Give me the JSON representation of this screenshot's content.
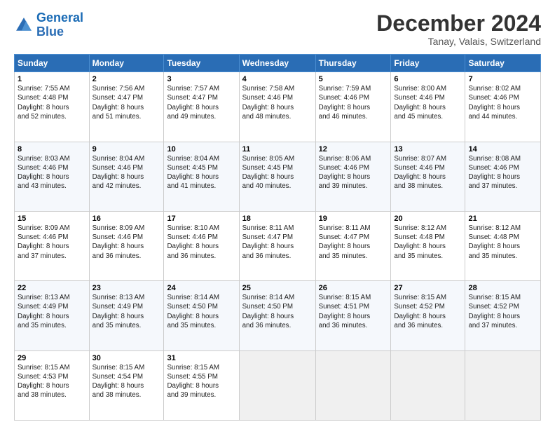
{
  "logo": {
    "line1": "General",
    "line2": "Blue"
  },
  "title": "December 2024",
  "subtitle": "Tanay, Valais, Switzerland",
  "days_header": [
    "Sunday",
    "Monday",
    "Tuesday",
    "Wednesday",
    "Thursday",
    "Friday",
    "Saturday"
  ],
  "weeks": [
    [
      {
        "day": "1",
        "info": "Sunrise: 7:55 AM\nSunset: 4:48 PM\nDaylight: 8 hours\nand 52 minutes."
      },
      {
        "day": "2",
        "info": "Sunrise: 7:56 AM\nSunset: 4:47 PM\nDaylight: 8 hours\nand 51 minutes."
      },
      {
        "day": "3",
        "info": "Sunrise: 7:57 AM\nSunset: 4:47 PM\nDaylight: 8 hours\nand 49 minutes."
      },
      {
        "day": "4",
        "info": "Sunrise: 7:58 AM\nSunset: 4:46 PM\nDaylight: 8 hours\nand 48 minutes."
      },
      {
        "day": "5",
        "info": "Sunrise: 7:59 AM\nSunset: 4:46 PM\nDaylight: 8 hours\nand 46 minutes."
      },
      {
        "day": "6",
        "info": "Sunrise: 8:00 AM\nSunset: 4:46 PM\nDaylight: 8 hours\nand 45 minutes."
      },
      {
        "day": "7",
        "info": "Sunrise: 8:02 AM\nSunset: 4:46 PM\nDaylight: 8 hours\nand 44 minutes."
      }
    ],
    [
      {
        "day": "8",
        "info": "Sunrise: 8:03 AM\nSunset: 4:46 PM\nDaylight: 8 hours\nand 43 minutes."
      },
      {
        "day": "9",
        "info": "Sunrise: 8:04 AM\nSunset: 4:46 PM\nDaylight: 8 hours\nand 42 minutes."
      },
      {
        "day": "10",
        "info": "Sunrise: 8:04 AM\nSunset: 4:45 PM\nDaylight: 8 hours\nand 41 minutes."
      },
      {
        "day": "11",
        "info": "Sunrise: 8:05 AM\nSunset: 4:45 PM\nDaylight: 8 hours\nand 40 minutes."
      },
      {
        "day": "12",
        "info": "Sunrise: 8:06 AM\nSunset: 4:46 PM\nDaylight: 8 hours\nand 39 minutes."
      },
      {
        "day": "13",
        "info": "Sunrise: 8:07 AM\nSunset: 4:46 PM\nDaylight: 8 hours\nand 38 minutes."
      },
      {
        "day": "14",
        "info": "Sunrise: 8:08 AM\nSunset: 4:46 PM\nDaylight: 8 hours\nand 37 minutes."
      }
    ],
    [
      {
        "day": "15",
        "info": "Sunrise: 8:09 AM\nSunset: 4:46 PM\nDaylight: 8 hours\nand 37 minutes."
      },
      {
        "day": "16",
        "info": "Sunrise: 8:09 AM\nSunset: 4:46 PM\nDaylight: 8 hours\nand 36 minutes."
      },
      {
        "day": "17",
        "info": "Sunrise: 8:10 AM\nSunset: 4:46 PM\nDaylight: 8 hours\nand 36 minutes."
      },
      {
        "day": "18",
        "info": "Sunrise: 8:11 AM\nSunset: 4:47 PM\nDaylight: 8 hours\nand 36 minutes."
      },
      {
        "day": "19",
        "info": "Sunrise: 8:11 AM\nSunset: 4:47 PM\nDaylight: 8 hours\nand 35 minutes."
      },
      {
        "day": "20",
        "info": "Sunrise: 8:12 AM\nSunset: 4:48 PM\nDaylight: 8 hours\nand 35 minutes."
      },
      {
        "day": "21",
        "info": "Sunrise: 8:12 AM\nSunset: 4:48 PM\nDaylight: 8 hours\nand 35 minutes."
      }
    ],
    [
      {
        "day": "22",
        "info": "Sunrise: 8:13 AM\nSunset: 4:49 PM\nDaylight: 8 hours\nand 35 minutes."
      },
      {
        "day": "23",
        "info": "Sunrise: 8:13 AM\nSunset: 4:49 PM\nDaylight: 8 hours\nand 35 minutes."
      },
      {
        "day": "24",
        "info": "Sunrise: 8:14 AM\nSunset: 4:50 PM\nDaylight: 8 hours\nand 35 minutes."
      },
      {
        "day": "25",
        "info": "Sunrise: 8:14 AM\nSunset: 4:50 PM\nDaylight: 8 hours\nand 36 minutes."
      },
      {
        "day": "26",
        "info": "Sunrise: 8:15 AM\nSunset: 4:51 PM\nDaylight: 8 hours\nand 36 minutes."
      },
      {
        "day": "27",
        "info": "Sunrise: 8:15 AM\nSunset: 4:52 PM\nDaylight: 8 hours\nand 36 minutes."
      },
      {
        "day": "28",
        "info": "Sunrise: 8:15 AM\nSunset: 4:52 PM\nDaylight: 8 hours\nand 37 minutes."
      }
    ],
    [
      {
        "day": "29",
        "info": "Sunrise: 8:15 AM\nSunset: 4:53 PM\nDaylight: 8 hours\nand 38 minutes."
      },
      {
        "day": "30",
        "info": "Sunrise: 8:15 AM\nSunset: 4:54 PM\nDaylight: 8 hours\nand 38 minutes."
      },
      {
        "day": "31",
        "info": "Sunrise: 8:15 AM\nSunset: 4:55 PM\nDaylight: 8 hours\nand 39 minutes."
      },
      {
        "day": "",
        "info": ""
      },
      {
        "day": "",
        "info": ""
      },
      {
        "day": "",
        "info": ""
      },
      {
        "day": "",
        "info": ""
      }
    ]
  ]
}
